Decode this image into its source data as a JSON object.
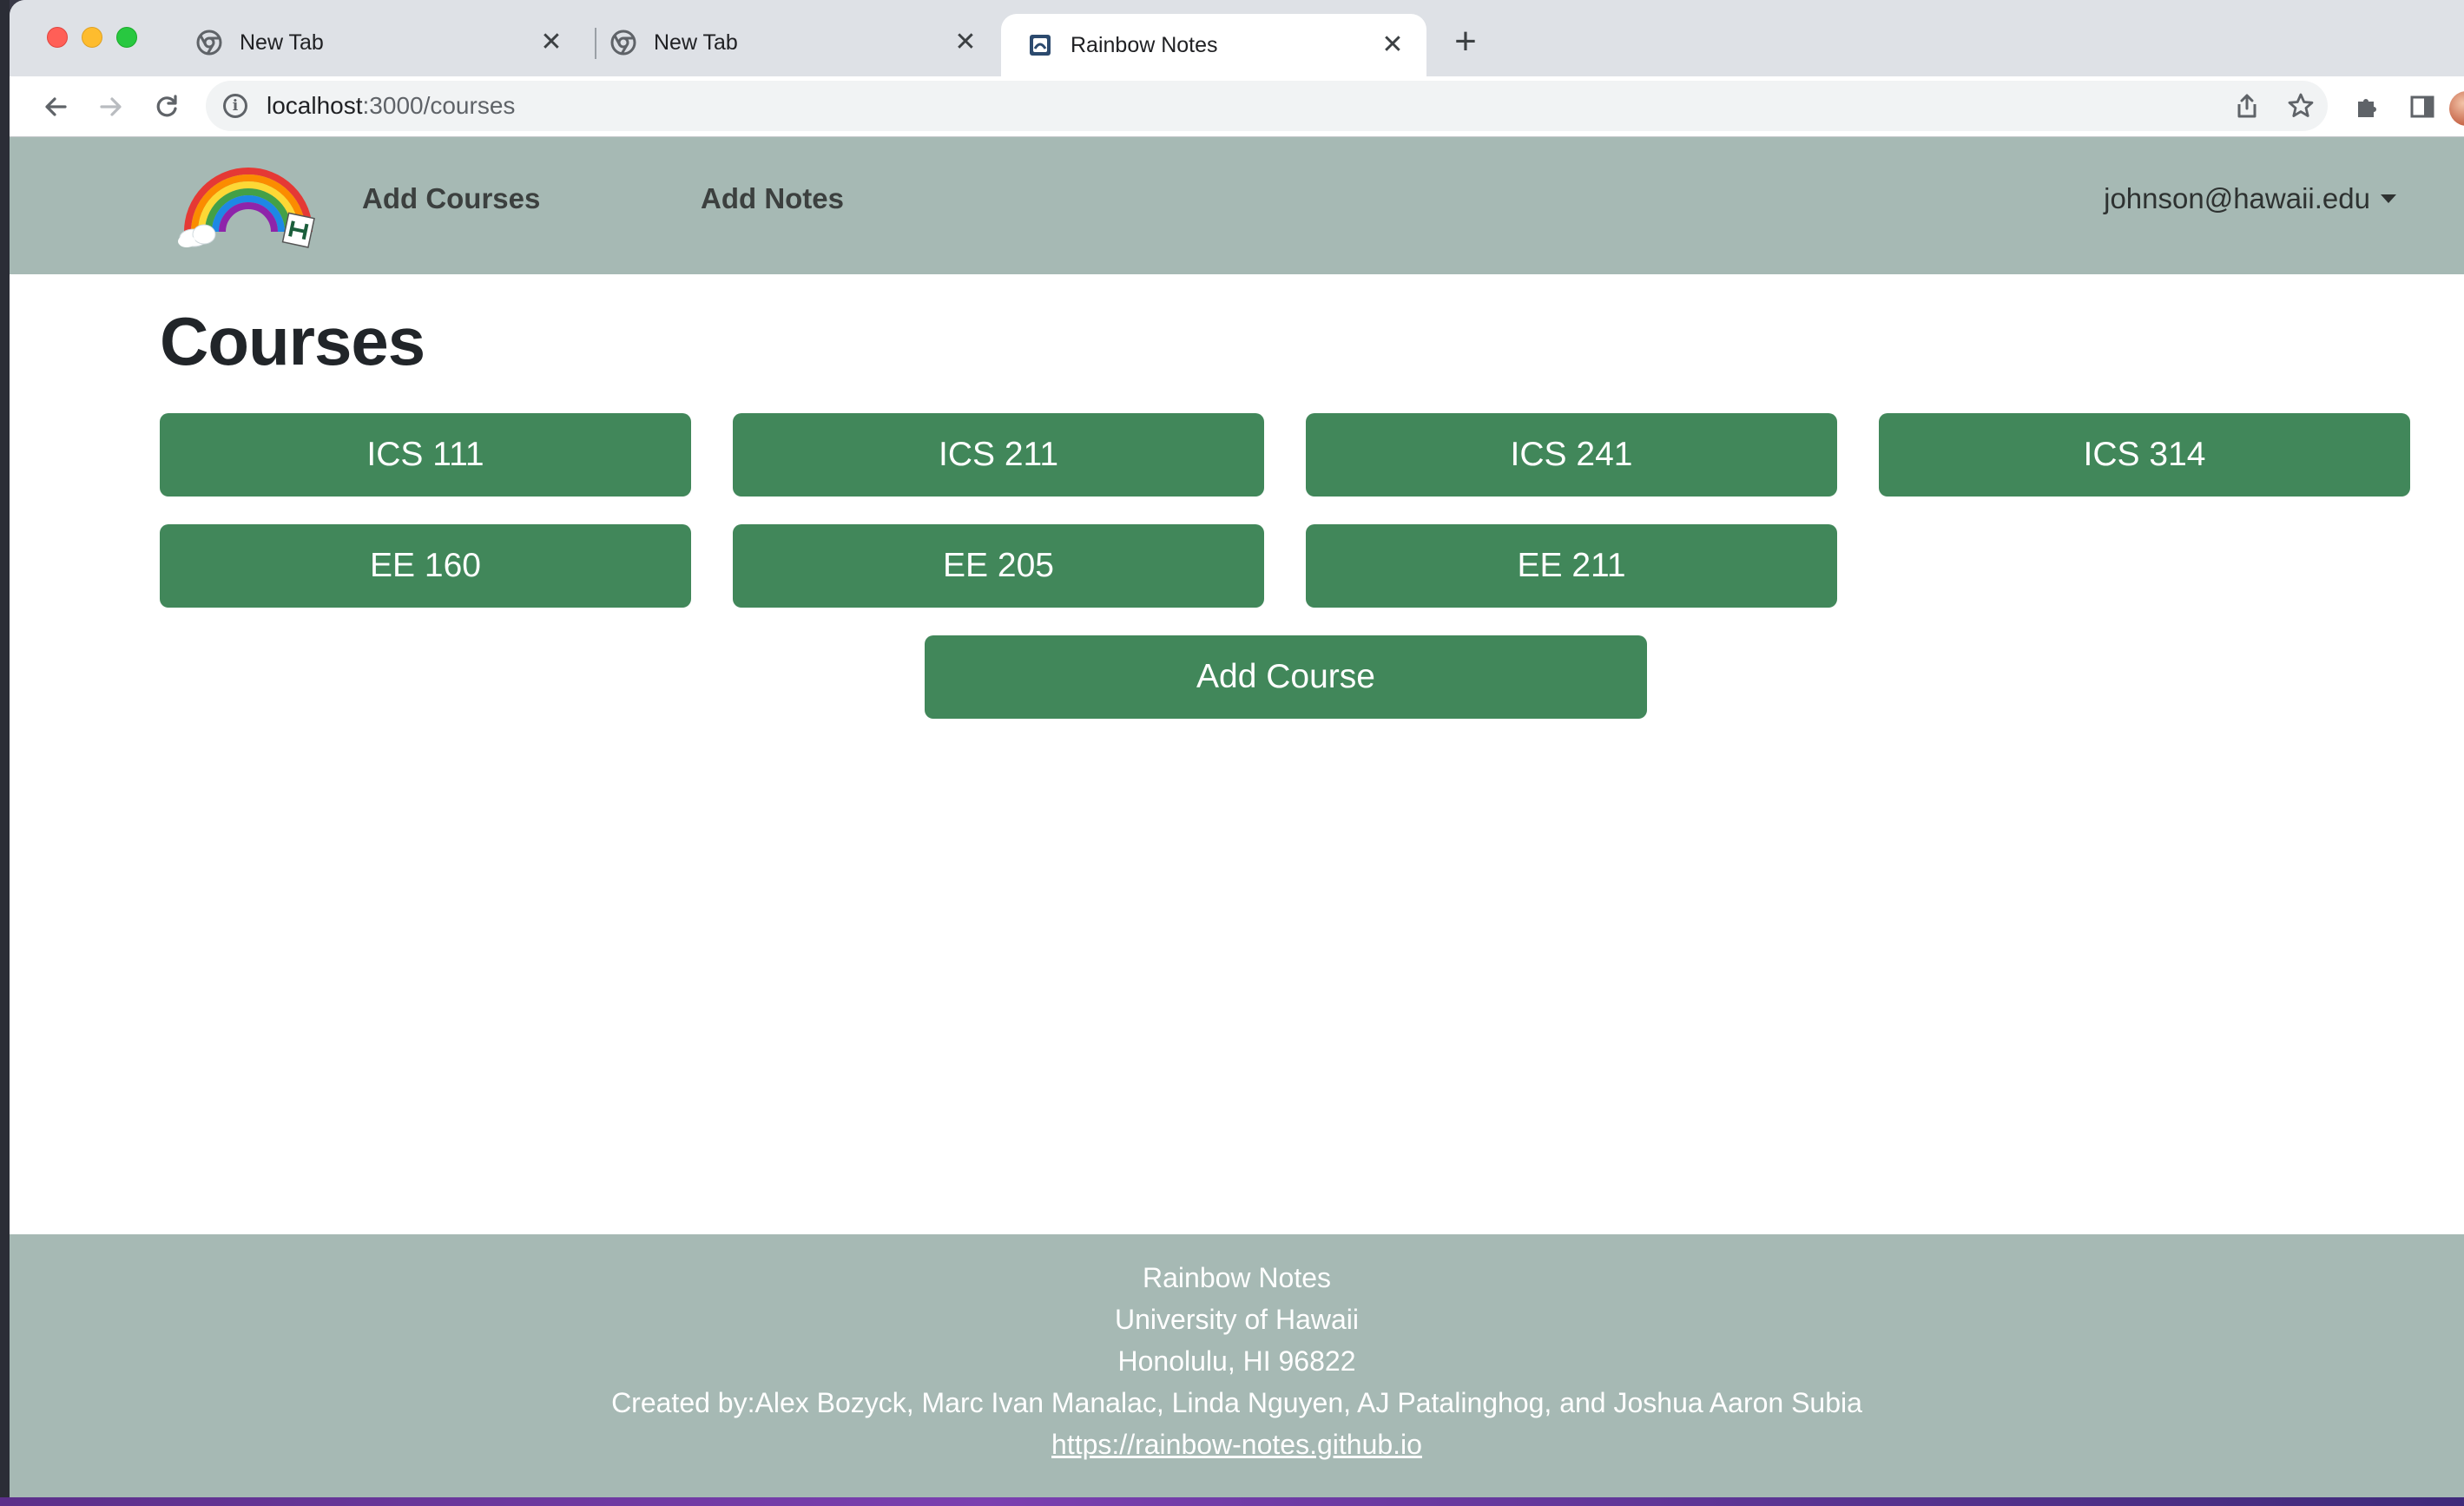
{
  "browser": {
    "tabs": [
      {
        "title": "New Tab"
      },
      {
        "title": "New Tab"
      },
      {
        "title": "Rainbow Notes"
      }
    ],
    "url_host": "localhost",
    "url_path": ":3000/courses"
  },
  "navbar": {
    "add_courses": "Add Courses",
    "add_notes": "Add Notes",
    "user": "johnson@hawaii.edu"
  },
  "main": {
    "title": "Courses",
    "courses": [
      "ICS 111",
      "ICS 211",
      "ICS 241",
      "ICS 314",
      "EE 160",
      "EE 205",
      "EE 211"
    ],
    "add_course": "Add Course"
  },
  "footer": {
    "line1": "Rainbow Notes",
    "line2": "University of Hawaii",
    "line3": "Honolulu, HI 96822",
    "line4": "Created by:Alex Bozyck, Marc Ivan Manalac, Linda Nguyen, AJ Patalinghog, and Joshua Aaron Subia",
    "link": "https://rainbow-notes.github.io"
  },
  "colors": {
    "navbar_bg": "#a6b9b4",
    "button_green": "#41875a"
  }
}
